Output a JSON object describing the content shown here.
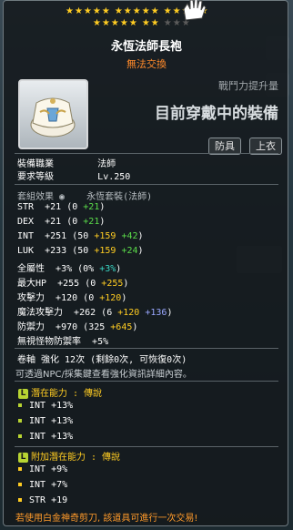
{
  "stars": {
    "row1": {
      "g1": "★★★★★",
      "g2": "★★★★★",
      "g3": "★★★★★"
    },
    "row2": {
      "g1": "★★★★★",
      "g2": "★★",
      "g3": "★★★"
    },
    "filled": 22,
    "max": 25
  },
  "item": {
    "name": "永恆法師長袍",
    "trade_status": "無法交換",
    "cp_label": "戰鬥力提升量",
    "cp_value": "目前穿戴中的裝備",
    "tags": [
      "防具",
      "上衣"
    ],
    "icon": "robe-icon"
  },
  "req": {
    "job_label": "裝備職業",
    "job_value": "法師",
    "level_label": "要求等級",
    "level_value": "Lv.250"
  },
  "set": {
    "label": "套組效果",
    "name": "永恆套裝(法師)"
  },
  "stats": [
    {
      "name": "STR",
      "total": "+21",
      "base": "0",
      "bonus": "+21"
    },
    {
      "name": "DEX",
      "total": "+21",
      "base": "0",
      "bonus": "+21"
    },
    {
      "name": "INT",
      "total": "+251",
      "base": "50",
      "star": "+159",
      "bonus": "+42"
    },
    {
      "name": "LUK",
      "total": "+233",
      "base": "50",
      "star": "+159",
      "bonus": "+24"
    },
    {
      "name": "全屬性",
      "total": "+3%",
      "base": "0%",
      "bonus": "+3%"
    },
    {
      "name": "最大HP",
      "total": "+255",
      "base": "0",
      "star": "+255"
    },
    {
      "name": "攻擊力",
      "total": "+120",
      "base": "0",
      "star": "+120"
    },
    {
      "name": "魔法攻擊力",
      "total": "+262",
      "base": "6",
      "star": "+120",
      "bonus": "+136"
    },
    {
      "name": "防禦力",
      "total": "+970",
      "base": "325",
      "star": "+645"
    },
    {
      "name": "無視怪物防禦率",
      "total": "+5%"
    }
  ],
  "upgrade": {
    "text": "卷軸 強化 12次 (剩餘0次, 可恢復0次)",
    "hint": "可透過NPC/採集鍵查看強化資訊詳細內容。"
  },
  "potential": {
    "badge": "L",
    "label": "潛在能力 : 傳說",
    "lines": [
      "INT +13%",
      "INT +13%",
      "INT +13%"
    ]
  },
  "bonus_potential": {
    "badge": "L",
    "label": "附加潛在能力 : 傳說",
    "lines": [
      "INT +9%",
      "INT +7%",
      "STR +19"
    ]
  },
  "footer": {
    "text": "若使用白金神奇剪刀, 該道具可進行一次交易!"
  },
  "colors": {
    "star": "#ffcc22",
    "untradeable": "#ff8a2a",
    "bonus_green": "#5bdc4a",
    "star_yellow": "#ffcc22",
    "legendary": "#b8d432"
  }
}
